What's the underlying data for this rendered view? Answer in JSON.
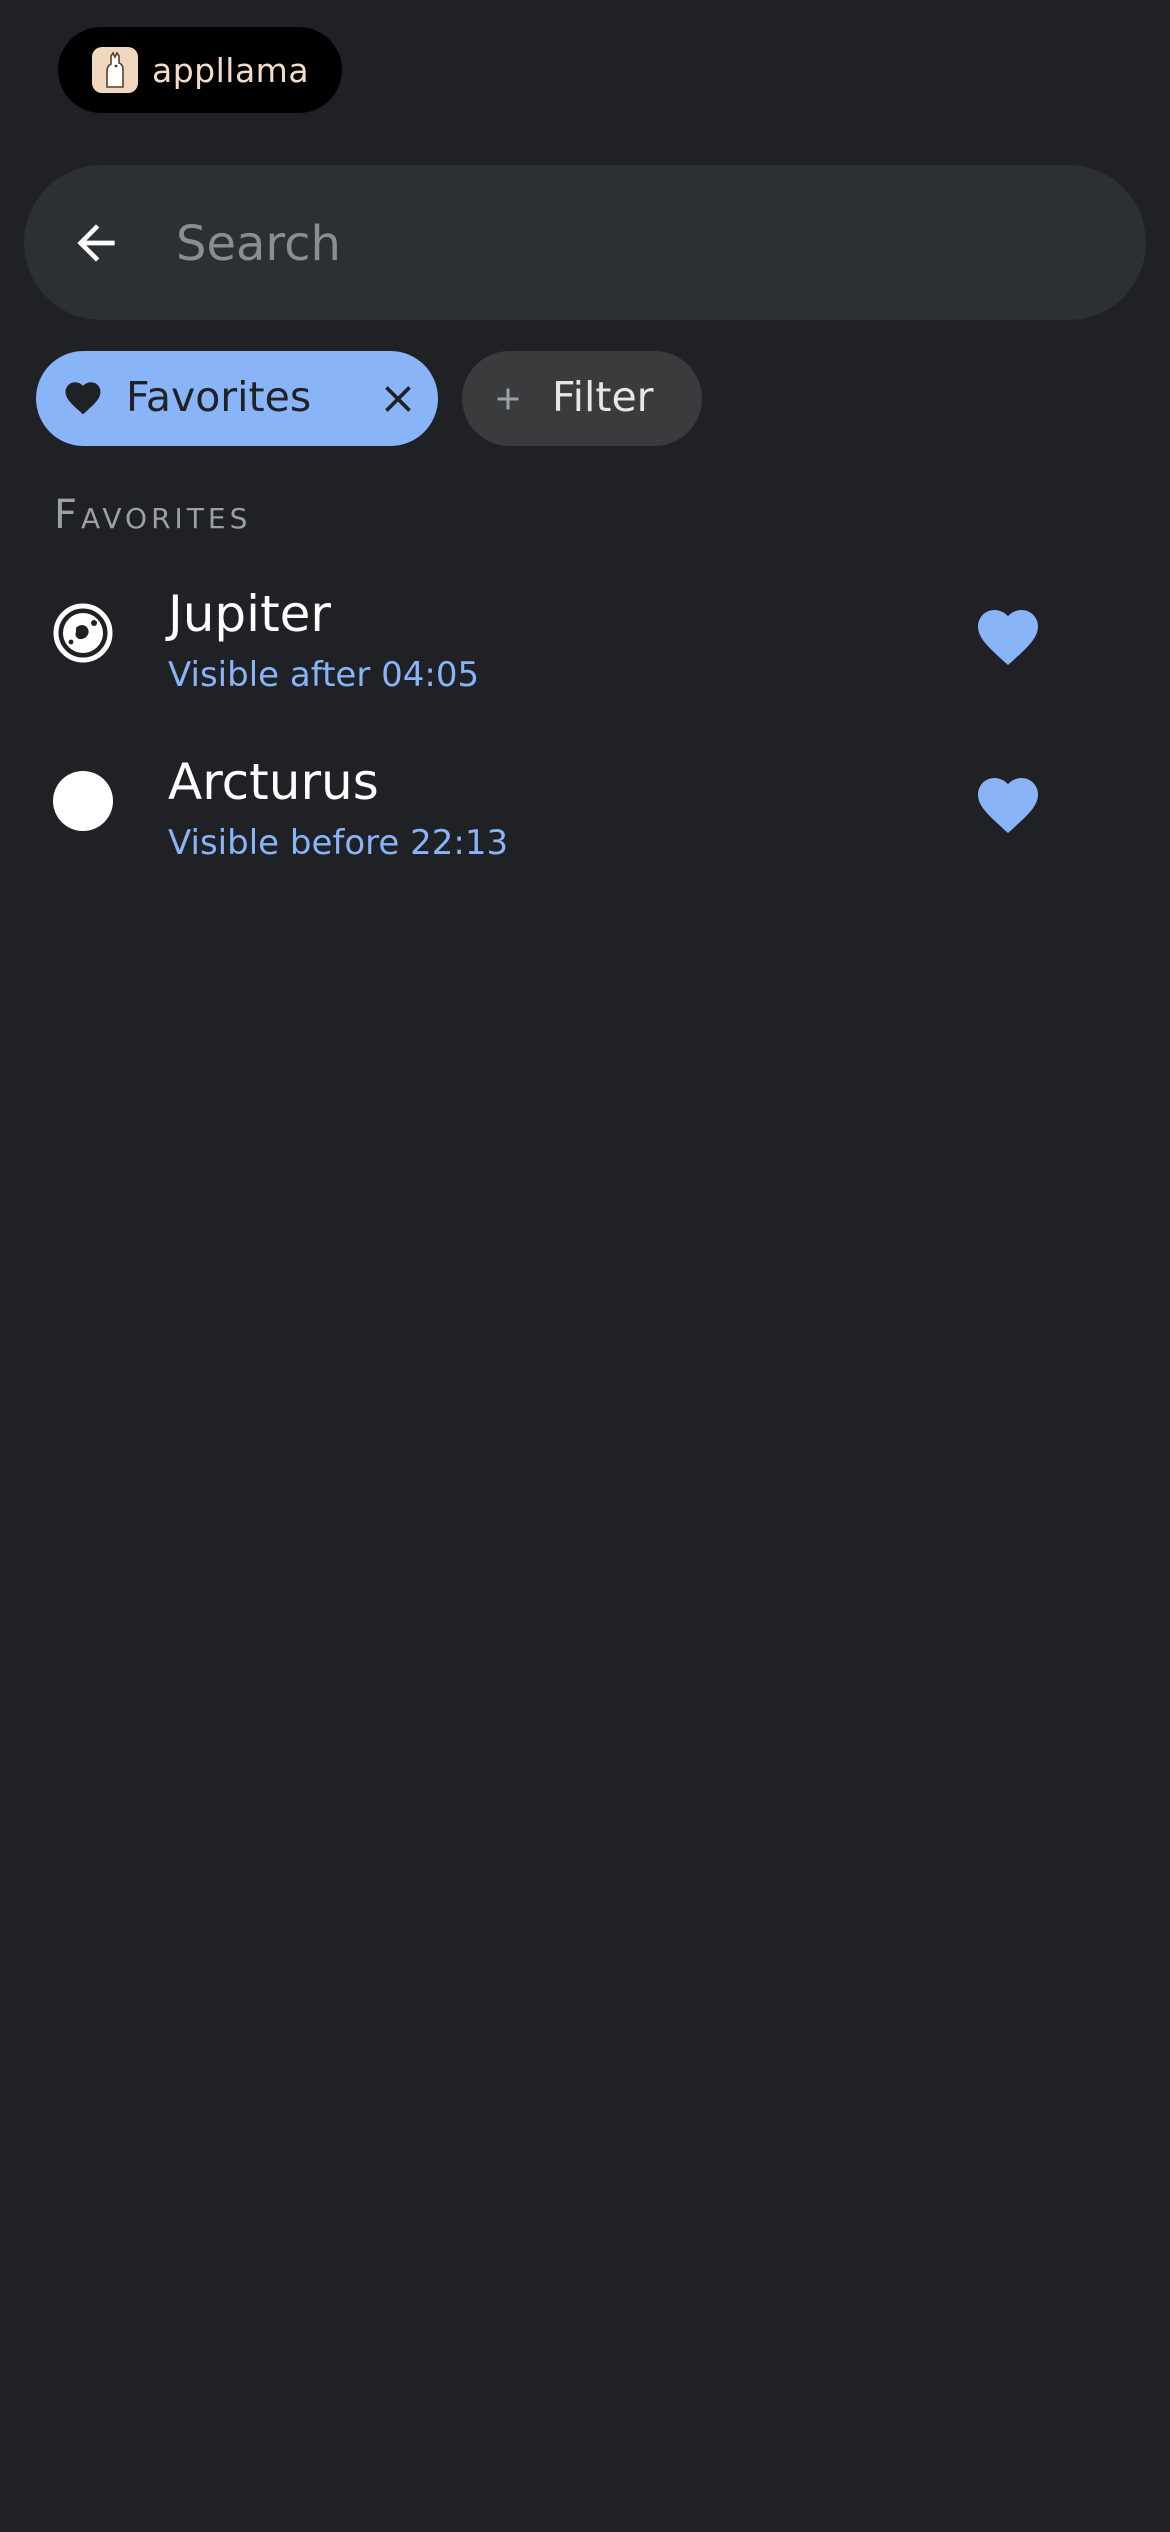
{
  "brand": {
    "name": "appllama",
    "logo_icon": "llama-icon"
  },
  "search": {
    "placeholder": "Search",
    "value": "",
    "back_icon": "arrow-left-icon"
  },
  "chips": {
    "favorites": {
      "label": "Favorites",
      "selected": true,
      "icon": "heart-icon",
      "close_icon": "close-icon"
    },
    "filter": {
      "label": "Filter",
      "icon": "plus-icon"
    }
  },
  "section": {
    "title": "Favorites"
  },
  "items": [
    {
      "name": "Jupiter",
      "subtitle": "Visible after 04:05",
      "icon": "planet-icon",
      "favorite": true
    },
    {
      "name": "Arcturus",
      "subtitle": "Visible before 22:13",
      "icon": "star-icon",
      "favorite": true
    }
  ],
  "colors": {
    "background": "#1f2125",
    "search_bar": "#2c2f33",
    "accent": "#8ab4f8",
    "chip_inactive": "#3a3b3d",
    "section_header": "#9aa0a6",
    "brand_text": "#f4dcc8"
  }
}
